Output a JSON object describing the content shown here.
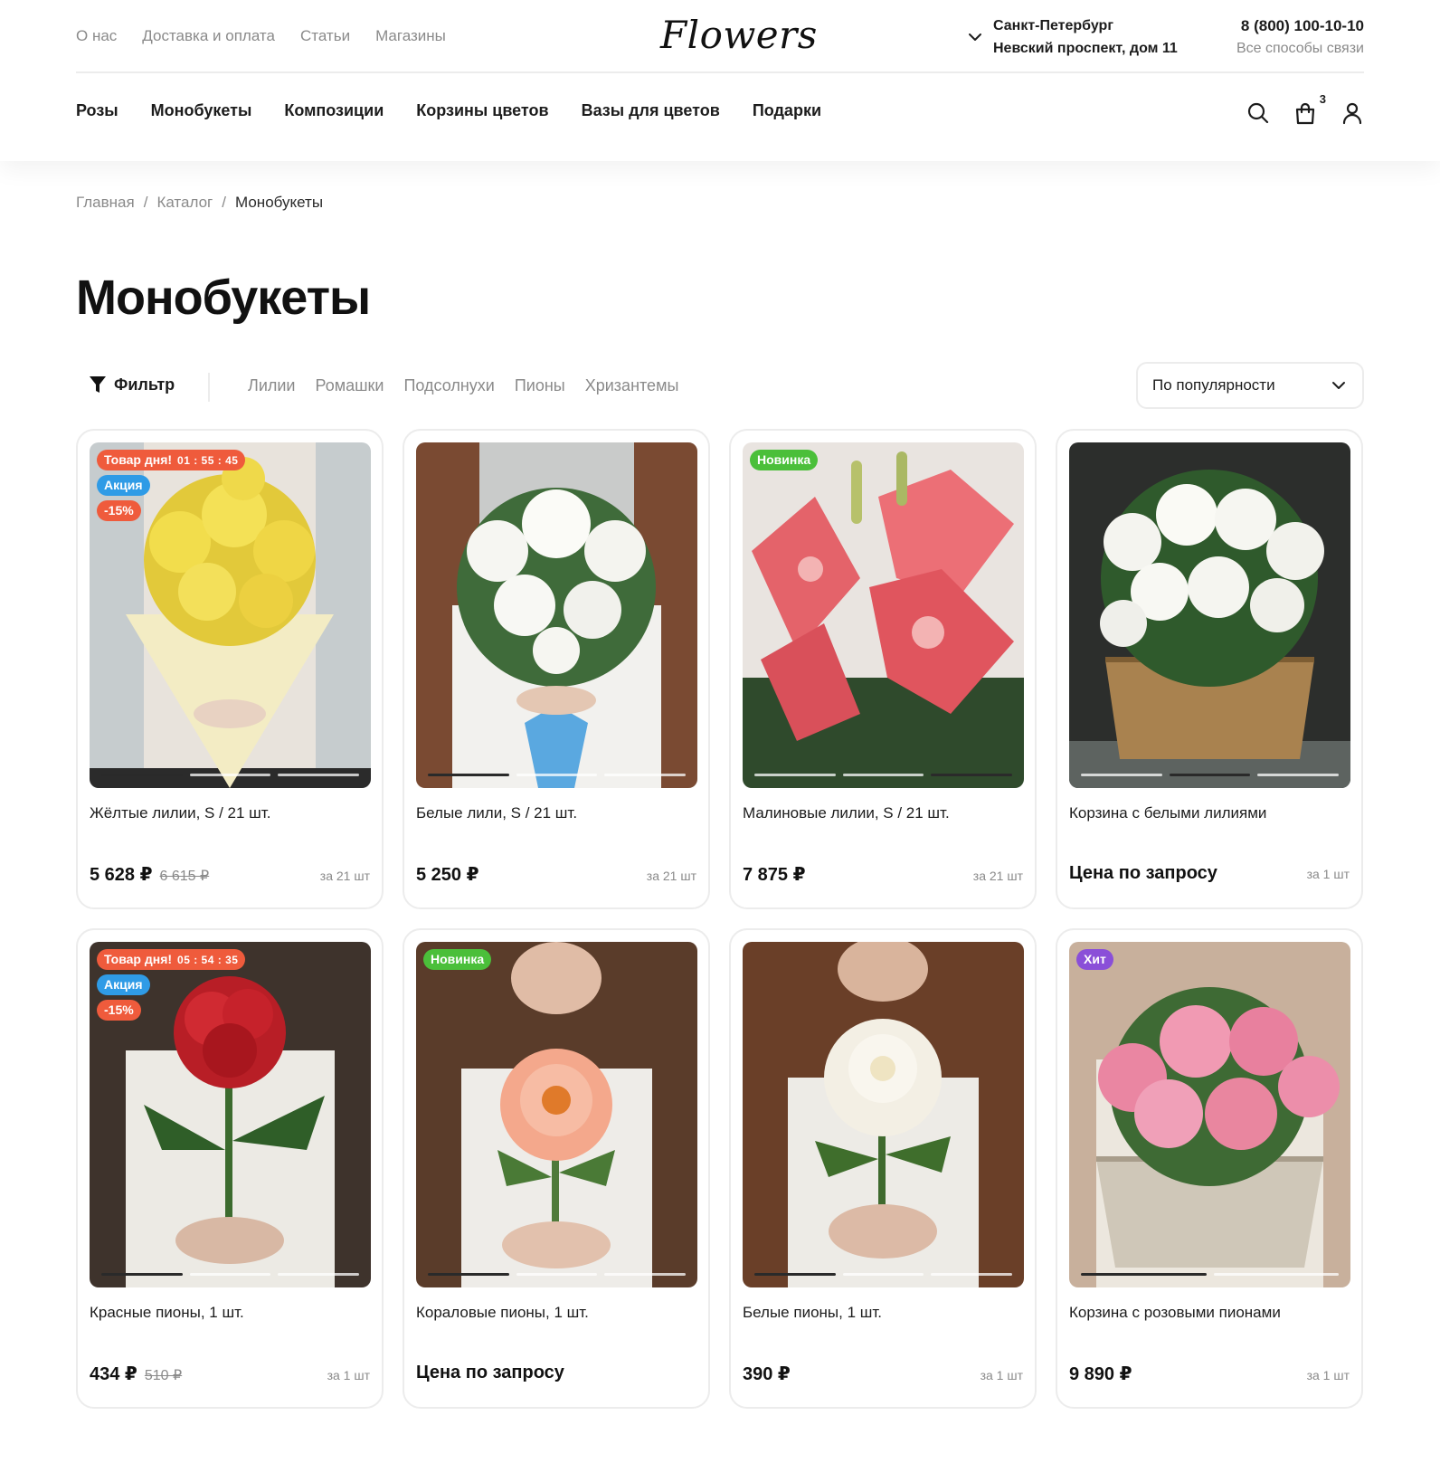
{
  "header": {
    "top_links": [
      "О нас",
      "Доставка и оплата",
      "Статьи",
      "Магазины"
    ],
    "logo": "Flowers",
    "city": "Санкт-Петербург",
    "address": "Невский проспект, дом 11",
    "phone": "8 (800) 100-10-10",
    "contact_link": "Все способы связи",
    "nav": [
      "Розы",
      "Монобукеты",
      "Композиции",
      "Корзины цветов",
      "Вазы для цветов",
      "Подарки"
    ],
    "cart_count": "3",
    "icons": [
      "search-icon",
      "cart-icon",
      "user-icon"
    ]
  },
  "breadcrumb": {
    "items": [
      "Главная",
      "Каталог"
    ],
    "separator": "/",
    "current": "Монобукеты"
  },
  "page_title": "Монобукеты",
  "filters": {
    "button_label": "Фильтр",
    "chips": [
      "Лилии",
      "Ромашки",
      "Подсолнухи",
      "Пионы",
      "Хризантемы"
    ],
    "sort_label": "По популярности"
  },
  "colors": {
    "accent_red": "#ef5b3c",
    "accent_blue": "#2f9be6",
    "badge_new": "#4bbf3a",
    "badge_hit": "#8a4fd8",
    "muted_text": "#8a8a8a",
    "border": "#ececec"
  },
  "products": [
    {
      "name": "Жёлтые лилии, S / 21 шт.",
      "price": "5 628 ₽",
      "old_price": "6 615 ₽",
      "per": "за 21 шт",
      "badge_day": "Товар дня!",
      "timer": "01 : 55 : 45",
      "badge_sale": "Акция",
      "badge_discount": "-15%",
      "badge_new": "",
      "badge_hit": "",
      "slides": 3,
      "active_slide": 1
    },
    {
      "name": "Белые лили, S / 21 шт.",
      "price": "5 250 ₽",
      "old_price": "",
      "per": "за 21 шт",
      "badge_day": "",
      "timer": "",
      "badge_sale": "",
      "badge_discount": "",
      "badge_new": "",
      "badge_hit": "",
      "slides": 3,
      "active_slide": 1
    },
    {
      "name": "Малиновые лилии, S / 21 шт.",
      "price": "7 875 ₽",
      "old_price": "",
      "per": "за 21 шт",
      "badge_day": "",
      "timer": "",
      "badge_sale": "",
      "badge_discount": "",
      "badge_new": "Новинка",
      "badge_hit": "",
      "slides": 3,
      "active_slide": 3
    },
    {
      "name": "Корзина с белыми лилиями",
      "price": "Цена по запросу",
      "old_price": "",
      "per": "за 1 шт",
      "badge_day": "",
      "timer": "",
      "badge_sale": "",
      "badge_discount": "",
      "badge_new": "",
      "badge_hit": "",
      "slides": 3,
      "active_slide": 2
    },
    {
      "name": "Красные пионы, 1 шт.",
      "price": "434 ₽",
      "old_price": "510 ₽",
      "per": "за 1 шт",
      "badge_day": "Товар дня!",
      "timer": "05 : 54 : 35",
      "badge_sale": "Акция",
      "badge_discount": "-15%",
      "badge_new": "",
      "badge_hit": "",
      "slides": 3,
      "active_slide": 1
    },
    {
      "name": "Кораловые пионы, 1 шт.",
      "price": "Цена по запросу",
      "old_price": "",
      "per": "",
      "badge_day": "",
      "timer": "",
      "badge_sale": "",
      "badge_discount": "",
      "badge_new": "Новинка",
      "badge_hit": "",
      "slides": 3,
      "active_slide": 1
    },
    {
      "name": "Белые пионы, 1 шт.",
      "price": "390 ₽",
      "old_price": "",
      "per": "за 1 шт",
      "badge_day": "",
      "timer": "",
      "badge_sale": "",
      "badge_discount": "",
      "badge_new": "",
      "badge_hit": "",
      "slides": 3,
      "active_slide": 1
    },
    {
      "name": "Корзина с розовыми пионами",
      "price": "9 890 ₽",
      "old_price": "",
      "per": "за 1 шт",
      "badge_day": "",
      "timer": "",
      "badge_sale": "",
      "badge_discount": "",
      "badge_new": "",
      "badge_hit": "Хит",
      "slides": 2,
      "active_slide": 1
    }
  ]
}
